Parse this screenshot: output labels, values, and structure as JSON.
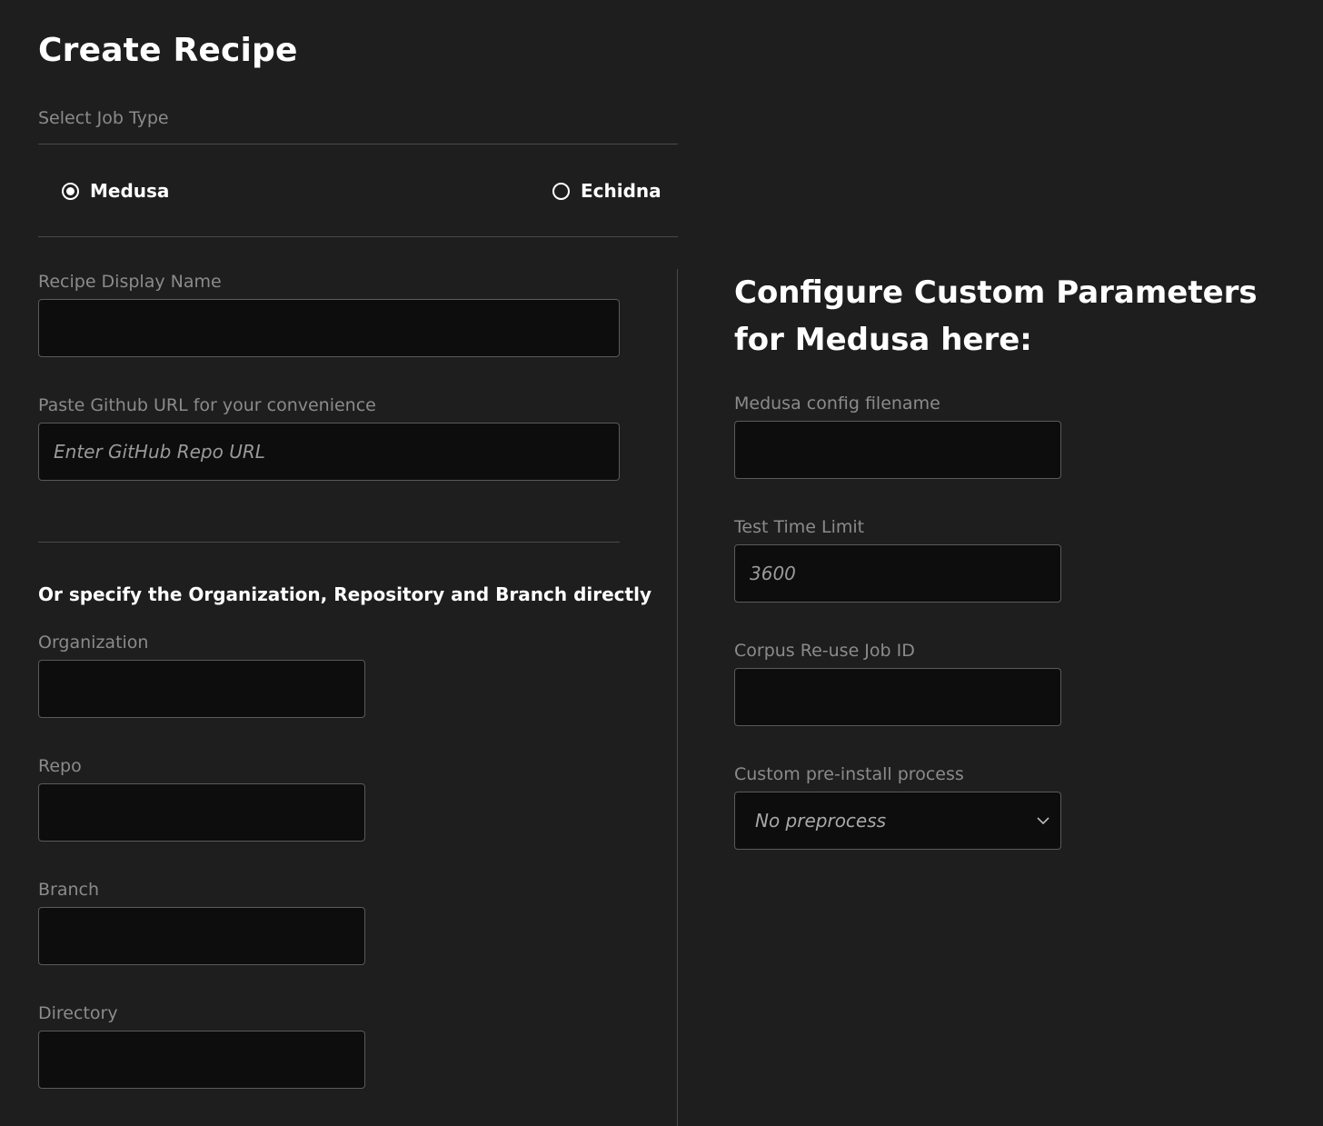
{
  "page": {
    "title": "Create Recipe"
  },
  "job_type": {
    "label": "Select Job Type",
    "options": [
      {
        "label": "Medusa",
        "checked": true
      },
      {
        "label": "Echidna",
        "checked": false
      }
    ]
  },
  "recipe_form": {
    "display_name_label": "Recipe Display Name",
    "display_name_value": "",
    "github_url_label": "Paste Github URL for your convenience",
    "github_url_placeholder": "Enter GitHub Repo URL",
    "direct_spec_text": "Or specify the Organization, Repository and Branch directly",
    "organization_label": "Organization",
    "repo_label": "Repo",
    "branch_label": "Branch",
    "directory_label": "Directory"
  },
  "custom_params": {
    "title": "Configure Custom Parameters for Medusa here:",
    "config_filename_label": "Medusa config filename",
    "test_time_limit_label": "Test Time Limit",
    "test_time_limit_placeholder": "3600",
    "corpus_job_id_label": "Corpus Re-use Job ID",
    "preinstall_label": "Custom pre-install process",
    "preinstall_selected": "No preprocess"
  },
  "icons": {
    "dropdown": "chevron-down-icon",
    "radio_checked": "radio-checked-icon",
    "radio_unchecked": "radio-unchecked-icon"
  }
}
